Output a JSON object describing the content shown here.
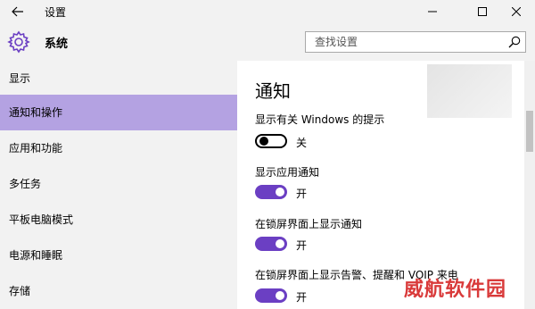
{
  "window": {
    "title": "设置"
  },
  "header": {
    "section_title": "系统",
    "search_placeholder": "查找设置"
  },
  "sidebar": {
    "items": [
      {
        "label": "显示"
      },
      {
        "label": "通知和操作",
        "active": true
      },
      {
        "label": "应用和功能"
      },
      {
        "label": "多任务"
      },
      {
        "label": "平板电脑模式"
      },
      {
        "label": "电源和睡眠"
      },
      {
        "label": "存储"
      }
    ]
  },
  "content": {
    "title": "通知",
    "settings": [
      {
        "label": "显示有关 Windows 的提示",
        "state": "关",
        "on": false
      },
      {
        "label": "显示应用通知",
        "state": "开",
        "on": true
      },
      {
        "label": "在锁屏界面上显示通知",
        "state": "开",
        "on": true
      },
      {
        "label": "在锁屏界面上显示告警、提醒和 VOIP 来电",
        "state": "开",
        "on": true
      }
    ]
  },
  "watermark": "威航软件园",
  "colors": {
    "accent": "#6b3fc3",
    "active_nav": "#b4a2e2",
    "chrome": "#f2f2f2",
    "watermark": "#d93a3a"
  },
  "icons": {
    "back": "back-arrow-icon",
    "settings": "gear-icon",
    "search": "search-icon",
    "minimize": "minimize-icon",
    "maximize": "maximize-icon",
    "close": "close-icon"
  }
}
